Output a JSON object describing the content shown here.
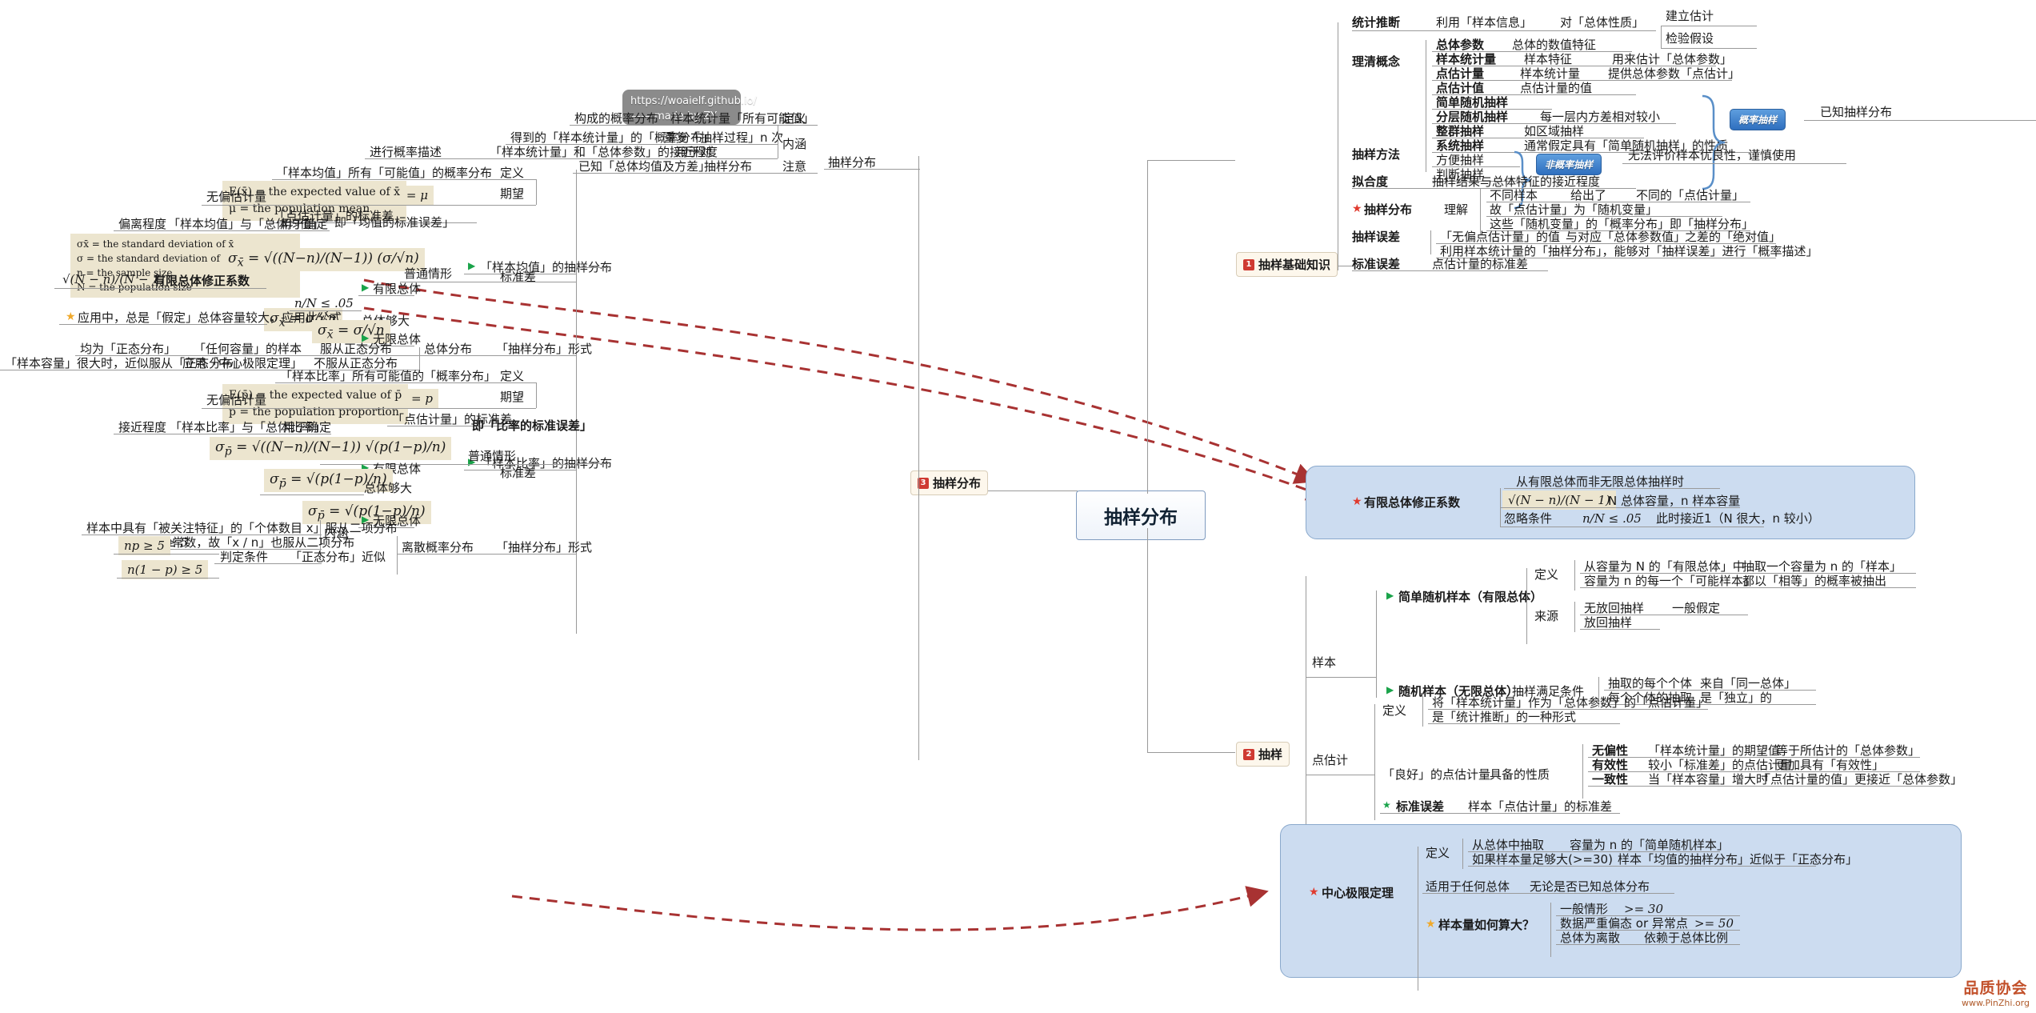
{
  "watermark": {
    "line1": "https://woaielf.github.io/",
    "line2": "—— made by ZY"
  },
  "center": {
    "title": "抽样分布"
  },
  "topics": [
    {
      "num": "1",
      "label": "抽样基础知识"
    },
    {
      "num": "2",
      "label": "抽样"
    },
    {
      "num": "3",
      "label": "抽样分布"
    }
  ],
  "branch1": {
    "tongji_tuiduan": {
      "label": "统计推断",
      "a": "利用「样本信息」",
      "b": "对「总体性质」",
      "c1": "建立估计",
      "c2": "检验假设"
    },
    "liqing_gainian": {
      "label": "理清概念",
      "rows": [
        {
          "k": "总体参数",
          "v": "总体的数值特征",
          "w": ""
        },
        {
          "k": "样本统计量",
          "v": "样本特征",
          "w": "用来估计「总体参数」"
        },
        {
          "k": "点估计量",
          "v": "样本统计量",
          "w": "提供总体参数「点估计」"
        },
        {
          "k": "点估计值",
          "v": "点估计量的值",
          "w": ""
        }
      ]
    },
    "chouyang_fangfa": {
      "label": "抽样方法",
      "rows": [
        {
          "k": "简单随机抽样",
          "v": ""
        },
        {
          "k": "分层随机抽样",
          "v": "每一层内方差相对较小"
        },
        {
          "k": "整群抽样",
          "v": "如区域抽样"
        },
        {
          "k": "系统抽样",
          "v": "通常假定具有「简单随机抽样」的性质"
        },
        {
          "k": "方便抽样",
          "v": ""
        },
        {
          "k": "判断抽样",
          "v": ""
        }
      ],
      "pill_prob": "概率抽样",
      "pill_nonprob": "非概率抽样",
      "prob_note": "已知抽样分布",
      "nonprob_note": "无法评价样本优良性，谨慎使用"
    },
    "nihedu": {
      "label": "拟合度",
      "v": "抽样结果与总体特征的接近程度"
    },
    "chouyang_fenbu": {
      "label": "抽样分布",
      "sub": "理解",
      "rows": [
        {
          "a": "不同样本",
          "b": "给出了",
          "c": "不同的「点估计量」"
        },
        {
          "a": "故「点估计量」为「随机变量」",
          "b": "",
          "c": ""
        },
        {
          "a": "这些「随机变量」的「概率分布」即「抽样分布」",
          "b": "",
          "c": ""
        }
      ]
    },
    "chouyang_wucha": {
      "label": "抽样误差",
      "rows": [
        {
          "a": "「无偏点估计量」的值",
          "b": "与对应「总体参数值」",
          "c": "之差的「绝对值」"
        },
        {
          "a": "利用样本统计量的「抽样分布」，能够对「抽样误差」进行「概率描述」",
          "b": "",
          "c": ""
        }
      ]
    },
    "biaozhun_wucha": {
      "label": "标准误差",
      "v": "点估计量的标准差"
    },
    "youxian_xiuzheng": {
      "label": "有限总体修正系数",
      "rows": [
        {
          "a": "从有限总体而非无限总体抽样时",
          "b": ""
        },
        {
          "a": "√(N − n)/(N − 1)",
          "b": "N 总体容量，n 样本容量"
        },
        {
          "a": "忽略条件",
          "b": "n/N ≤ .05",
          "c": "此时接近1（N 很大，n 较小）"
        }
      ]
    }
  },
  "branch2": {
    "yangben": {
      "label": "样本",
      "simple": {
        "label": "简单随机样本（有限总体）",
        "def_label": "定义",
        "defs": [
          {
            "a": "从容量为 N 的「有限总体」中",
            "b": "抽取一个容量为 n 的「样本」"
          },
          {
            "a": "容量为 n 的每一个「可能样本」",
            "b": "都以「相等」的概率被抽出"
          }
        ],
        "src_label": "来源",
        "srcs": [
          {
            "a": "无放回抽样",
            "b": "一般假定"
          },
          {
            "a": "放回抽样",
            "b": ""
          }
        ]
      },
      "random": {
        "label": "随机样本（无限总体）",
        "cond_label": "抽样满足条件",
        "conds": [
          {
            "a": "抽取的每个个体",
            "b": "来自「同一总体」"
          },
          {
            "a": "每个个体的抽取",
            "b": "是「独立」的"
          }
        ]
      }
    },
    "dianguji": {
      "label": "点估计",
      "def_label": "定义",
      "defs": [
        "将「样本统计量」作为「总体参数」的「点估计量」",
        "是「统计推断」的一种形式"
      ],
      "good_label": "「良好」的点估计量",
      "good_sub": "具备的性质",
      "props": [
        {
          "k": "无偏性",
          "a": "「样本统计量」的期望值",
          "b": "等于所估计的「总体参数」"
        },
        {
          "k": "有效性",
          "a": "较小「标准差」的点估计量",
          "b": "更加具有「有效性」"
        },
        {
          "k": "一致性",
          "a": "当「样本容量」增大时",
          "b": "「点估计量的值」更接近「总体参数」"
        }
      ],
      "se_label": "标准误差",
      "se_value": "样本「点估计量」的标准差"
    },
    "clt": {
      "label": "中心极限定理",
      "def_label": "定义",
      "defs": [
        {
          "a": "从总体中抽取",
          "b": "容量为 n 的「简单随机样本」"
        },
        {
          "a": "如果样本量足够大(>=30)",
          "b": "样本「均值的抽样分布」近似于「正态分布」"
        }
      ],
      "any_pop": "适用于任何总体",
      "any_pop_note": "无论是否已知总体分布",
      "big_label": "样本量如何算大？",
      "big_rows": [
        {
          "a": "一般情形",
          "b": ">= 30"
        },
        {
          "a": "数据严重偏态 or 异常点",
          "b": ">= 50"
        },
        {
          "a": "总体为离散",
          "b": "依赖于总体比例"
        }
      ]
    }
  },
  "branch3": {
    "chouyang_fenbu": {
      "label": "抽样分布",
      "rows": [
        {
          "k": "定义",
          "a": "样本统计量「所有可能值」",
          "b": "构成的概率分布"
        },
        {
          "k": "内涵",
          "a": "重复「抽样过程」n 次",
          "b": "得到的「样本统计量」的「概率分布」"
        },
        {
          "k": "",
          "a": "用于对",
          "b": "「样本统计量」和「总体参数」的接近程度",
          "c": "进行概率描述"
        },
        {
          "k": "注意",
          "a": "抽样分布",
          "b": "已知「总体均值及方差」"
        }
      ]
    },
    "mean_dist": {
      "label": "「样本均值」的抽样分布",
      "def_label": "定义",
      "def_value": "「样本均值」所有「可能值」的概率分布",
      "unbiased_label": "无偏估计量",
      "unbiased_note": "E(x̄) = the expected value of x̄\nμ = the population mean",
      "unbiased_formula": "E(x̄) = μ",
      "expect_label": "期望",
      "sd_label": "标准差",
      "sd_sub": "「点估计量」的标准差",
      "sd_sub2": "即「均值的标准误差」",
      "sd_used": "用于确定",
      "sd_used2": "「样本均值」与「总体均值」",
      "sd_used3": "偏离程度",
      "legend": "σx̄ = the standard deviation of x̄\nσ = the standard deviation of the population\nn = the sample size\nN = the population size",
      "fpc_formula": "√(N − n)/(N − 1)",
      "fpc_label": "有限总体修正系数",
      "normal_case": "普通情形",
      "finite": "有限总体",
      "cond": "n/N ≤ .05",
      "starnote": "应用中，总是「假定」总体容量较大，应用此公式",
      "bigpop": "总体够大",
      "infinite": "无限总体",
      "shape_label": "「抽样分布」形式",
      "shape_sub": "总体分布",
      "shape_rows": [
        {
          "a": "服从正态分布",
          "b": "「任何容量」的样本",
          "c": "均为「正态分布」"
        },
        {
          "a": "不服从正态分布",
          "b": "应用「中心极限定理」",
          "c": "「样本容量」很大时，近似服从「正态分布」"
        }
      ]
    },
    "prop_dist": {
      "label": "「样本比率」的抽样分布",
      "def_label": "定义",
      "def_value": "「样本比率」所有可能值的「概率分布」",
      "unbiased_label": "无偏估计量",
      "unbiased_note": "E(p̄) = the expected value of p̄\np = the population proportion",
      "unbiased_formula": "E(p̄) = p",
      "expect_label": "期望",
      "sd_label": "标准差",
      "sd_sub": "「点估计量」的标准差",
      "sd_sub2": "即「比率的标准误差」",
      "sd_used": "用于确定",
      "sd_used2": "「样本比率」与「总体比率」",
      "sd_used3": "接近程度",
      "normal_case": "普通情形",
      "finite": "有限总体",
      "bigpop": "总体够大",
      "infinite": "无限总体",
      "shape_label": "「抽样分布」形式",
      "shape_sub": "离散概率分布",
      "shape_sub2": "内涵",
      "shape_rows": [
        "样本中具有「被关注特征」的「个体数目 x」服从二项分布",
        "n 为常数，故「x / n」也服从二项分布"
      ],
      "approx_label": "「正态分布」近似",
      "approx_cond": "判定条件",
      "approx_rows": [
        "np ≥ 5",
        "n(1 − p) ≥ 5"
      ]
    }
  },
  "logo": {
    "big": "品质协会",
    "small": "www.PinZhi.org"
  }
}
